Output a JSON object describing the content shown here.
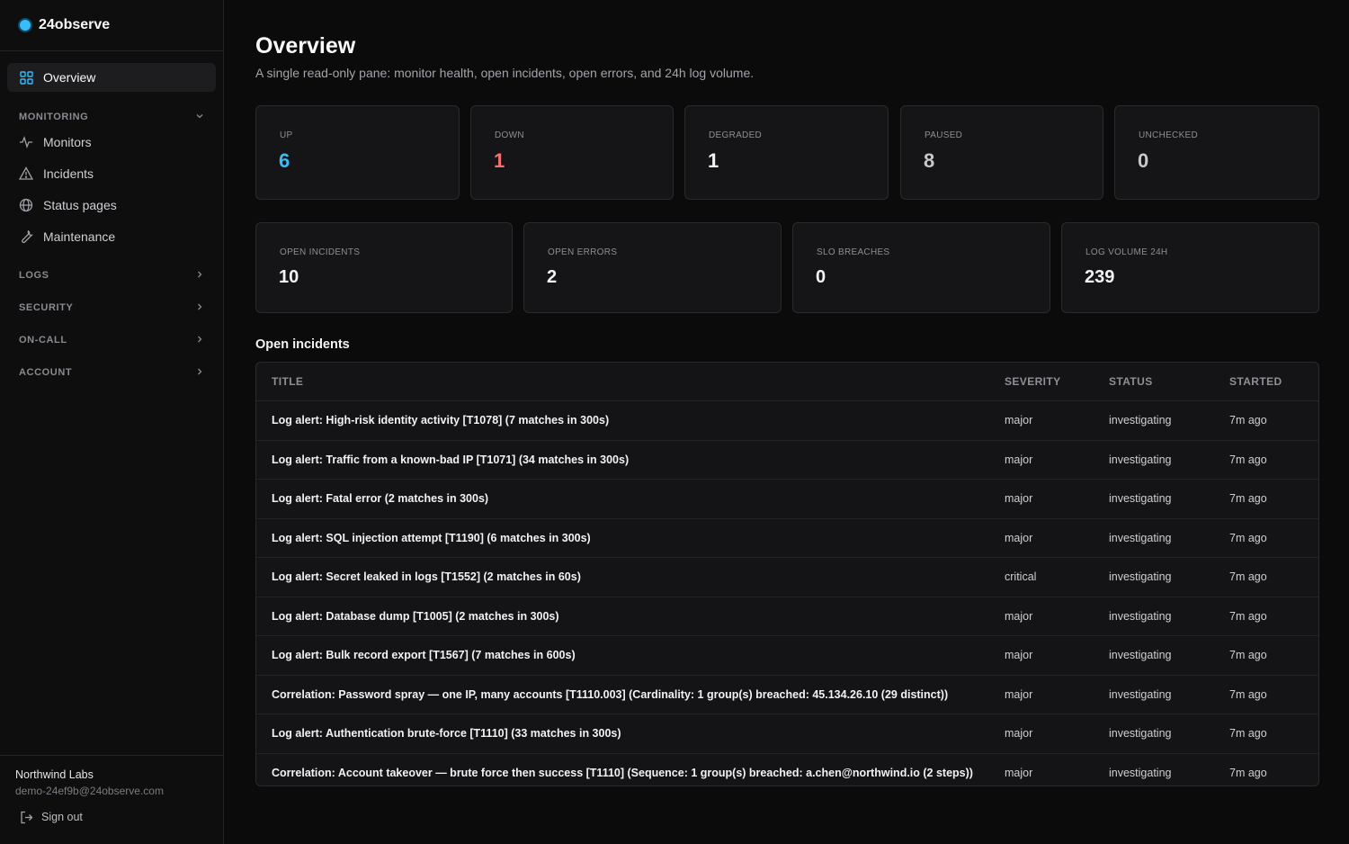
{
  "brand": {
    "name": "24observe"
  },
  "nav": {
    "active": "Overview",
    "groups": [
      {
        "label": "MONITORING",
        "items": [
          "Monitors",
          "Incidents",
          "Status pages",
          "Maintenance"
        ]
      },
      {
        "label": "LOGS"
      },
      {
        "label": "SECURITY"
      },
      {
        "label": "ON-CALL"
      },
      {
        "label": "ACCOUNT"
      }
    ]
  },
  "footer": {
    "org": "Northwind Labs",
    "email": "demo-24ef9b@24observe.com",
    "signout": "Sign out"
  },
  "header": {
    "title": "Overview",
    "subtitle": "A single read-only pane: monitor health, open incidents, open errors, and 24h log volume."
  },
  "monitor_stats": [
    {
      "label": "UP",
      "value": "6",
      "color": "#38bdf8"
    },
    {
      "label": "DOWN",
      "value": "1",
      "color": "#f87171"
    },
    {
      "label": "DEGRADED",
      "value": "1",
      "color": "#f3f3f3"
    },
    {
      "label": "PAUSED",
      "value": "8",
      "color": "#c8c8cc"
    },
    {
      "label": "UNCHECKED",
      "value": "0",
      "color": "#c8c8cc"
    }
  ],
  "summary_stats": [
    {
      "label": "OPEN INCIDENTS",
      "value": "10"
    },
    {
      "label": "OPEN ERRORS",
      "value": "2"
    },
    {
      "label": "SLO BREACHES",
      "value": "0"
    },
    {
      "label": "LOG VOLUME 24H",
      "value": "239"
    }
  ],
  "incidents": {
    "section_title": "Open incidents",
    "columns": [
      "TITLE",
      "SEVERITY",
      "STATUS",
      "STARTED"
    ],
    "rows": [
      [
        "Log alert: High-risk identity activity [T1078] (7 matches in 300s)",
        "major",
        "investigating",
        "7m ago"
      ],
      [
        "Log alert: Traffic from a known-bad IP [T1071] (34 matches in 300s)",
        "major",
        "investigating",
        "7m ago"
      ],
      [
        "Log alert: Fatal error (2 matches in 300s)",
        "major",
        "investigating",
        "7m ago"
      ],
      [
        "Log alert: SQL injection attempt [T1190] (6 matches in 300s)",
        "major",
        "investigating",
        "7m ago"
      ],
      [
        "Log alert: Secret leaked in logs [T1552] (2 matches in 60s)",
        "critical",
        "investigating",
        "7m ago"
      ],
      [
        "Log alert: Database dump [T1005] (2 matches in 300s)",
        "major",
        "investigating",
        "7m ago"
      ],
      [
        "Log alert: Bulk record export [T1567] (7 matches in 600s)",
        "major",
        "investigating",
        "7m ago"
      ],
      [
        "Correlation: Password spray — one IP, many accounts [T1110.003] (Cardinality: 1 group(s) breached: 45.134.26.10 (29 distinct))",
        "major",
        "investigating",
        "7m ago"
      ],
      [
        "Log alert: Authentication brute-force [T1110] (33 matches in 300s)",
        "major",
        "investigating",
        "7m ago"
      ],
      [
        "Correlation: Account takeover — brute force then success [T1110] (Sequence: 1 group(s) breached: a.chen@northwind.io (2 steps))",
        "major",
        "investigating",
        "7m ago"
      ]
    ]
  }
}
